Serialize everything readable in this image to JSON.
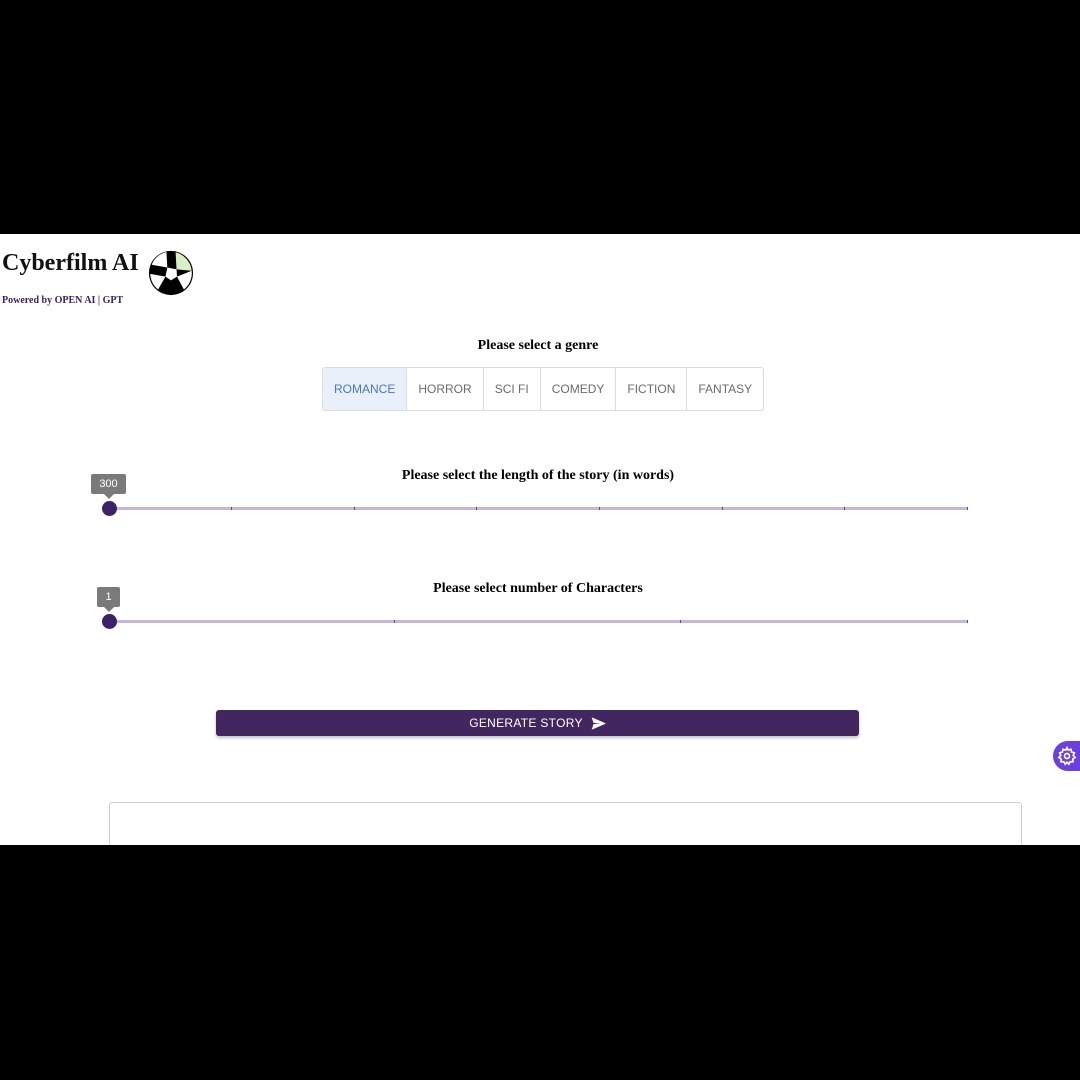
{
  "header": {
    "title": "Cyberfilm AI",
    "tagline": "Powered by OPEN AI | GPT",
    "logo_icon": "camera-aperture-icon"
  },
  "genre": {
    "prompt": "Please select a genre",
    "options": [
      "ROMANCE",
      "HORROR",
      "SCI FI",
      "COMEDY",
      "FICTION",
      "FANTASY"
    ],
    "selected": "ROMANCE"
  },
  "length_slider": {
    "label": "Please select the length of the story (in words)",
    "value": "300"
  },
  "characters_slider": {
    "label": "Please select number of Characters",
    "value": "1"
  },
  "generate": {
    "label": "GENERATE STORY",
    "icon": "send-icon"
  },
  "settings": {
    "icon": "gear-icon"
  },
  "colors": {
    "brand": "#42265f",
    "accent": "#4a76c8",
    "fab": "#6b3fe0"
  }
}
